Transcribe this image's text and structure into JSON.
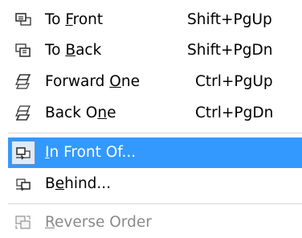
{
  "menu": {
    "items": [
      {
        "pre": "To ",
        "u": "F",
        "post": "ront",
        "shortcut": "Shift+PgUp",
        "icon": "to-front-icon"
      },
      {
        "pre": "To ",
        "u": "B",
        "post": "ack",
        "shortcut": "Shift+PgDn",
        "icon": "to-back-icon"
      },
      {
        "pre": "Forward ",
        "u": "O",
        "post": "ne",
        "shortcut": "Ctrl+PgUp",
        "icon": "forward-one-icon"
      },
      {
        "pre": "Back O",
        "u": "n",
        "post": "e",
        "shortcut": "Ctrl+PgDn",
        "icon": "back-one-icon"
      },
      {
        "pre": "",
        "u": "I",
        "post": "n Front Of...",
        "shortcut": "",
        "icon": "in-front-of-icon",
        "highlighted": true
      },
      {
        "pre": "B",
        "u": "e",
        "post": "hind...",
        "shortcut": "",
        "icon": "behind-icon"
      },
      {
        "pre": "",
        "u": "R",
        "post": "everse Order",
        "shortcut": "",
        "icon": "reverse-order-icon",
        "disabled": true
      }
    ]
  },
  "colors": {
    "highlight": "#3399ff",
    "highlight_text": "#ffffff",
    "disabled_text": "#8a8a8a",
    "separator": "#d7d7d7"
  }
}
